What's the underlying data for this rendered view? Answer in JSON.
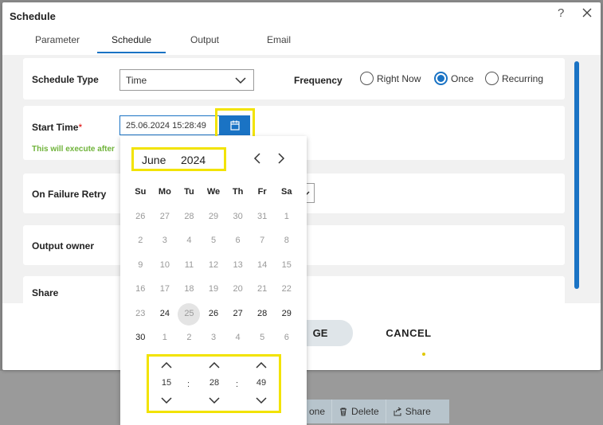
{
  "dialog": {
    "title": "Schedule",
    "help_label": "?",
    "tabs": [
      {
        "label": "Parameter",
        "active": false
      },
      {
        "label": "Schedule",
        "active": true
      },
      {
        "label": "Output",
        "active": false
      },
      {
        "label": "Email",
        "active": false
      }
    ]
  },
  "schedule_type": {
    "label": "Schedule Type",
    "value": "Time",
    "frequency_label": "Frequency",
    "options": [
      {
        "label": "Right Now",
        "checked": false
      },
      {
        "label": "Once",
        "checked": true
      },
      {
        "label": "Recurring",
        "checked": false
      }
    ]
  },
  "start_time": {
    "label": "Start Time",
    "required_mark": "*",
    "value": "25.06.2024 15:28:49",
    "note": "This will execute after"
  },
  "on_failure_retry": {
    "label": "On Failure Retry"
  },
  "output_owner": {
    "label": "Output owner"
  },
  "share": {
    "label": "Share"
  },
  "footer": {
    "change_label": "GE",
    "cancel_label": "CANCEL"
  },
  "background_toolbar": {
    "items": [
      {
        "label": "one",
        "icon": "partial-icon"
      },
      {
        "label": "Delete",
        "icon": "trash-icon"
      },
      {
        "label": "Share",
        "icon": "share-icon"
      }
    ]
  },
  "date_picker": {
    "month": "June",
    "year": "2024",
    "weekdays": [
      "Su",
      "Mo",
      "Tu",
      "We",
      "Th",
      "Fr",
      "Sa"
    ],
    "weeks": [
      [
        {
          "d": "26",
          "cur": false
        },
        {
          "d": "27",
          "cur": false
        },
        {
          "d": "28",
          "cur": false
        },
        {
          "d": "29",
          "cur": false
        },
        {
          "d": "30",
          "cur": false
        },
        {
          "d": "31",
          "cur": false
        },
        {
          "d": "1",
          "cur": false
        }
      ],
      [
        {
          "d": "2",
          "cur": false
        },
        {
          "d": "3",
          "cur": false
        },
        {
          "d": "4",
          "cur": false
        },
        {
          "d": "5",
          "cur": false
        },
        {
          "d": "6",
          "cur": false
        },
        {
          "d": "7",
          "cur": false
        },
        {
          "d": "8",
          "cur": false
        }
      ],
      [
        {
          "d": "9",
          "cur": false
        },
        {
          "d": "10",
          "cur": false
        },
        {
          "d": "11",
          "cur": false
        },
        {
          "d": "12",
          "cur": false
        },
        {
          "d": "13",
          "cur": false
        },
        {
          "d": "14",
          "cur": false
        },
        {
          "d": "15",
          "cur": false
        }
      ],
      [
        {
          "d": "16",
          "cur": false
        },
        {
          "d": "17",
          "cur": false
        },
        {
          "d": "18",
          "cur": false
        },
        {
          "d": "19",
          "cur": false
        },
        {
          "d": "20",
          "cur": false
        },
        {
          "d": "21",
          "cur": false
        },
        {
          "d": "22",
          "cur": false
        }
      ],
      [
        {
          "d": "23",
          "cur": false
        },
        {
          "d": "24",
          "cur": true
        },
        {
          "d": "25",
          "cur": false,
          "selected": true
        },
        {
          "d": "26",
          "cur": true
        },
        {
          "d": "27",
          "cur": true
        },
        {
          "d": "28",
          "cur": true
        },
        {
          "d": "29",
          "cur": true
        }
      ],
      [
        {
          "d": "30",
          "cur": true
        },
        {
          "d": "1",
          "cur": false
        },
        {
          "d": "2",
          "cur": false
        },
        {
          "d": "3",
          "cur": false
        },
        {
          "d": "4",
          "cur": false
        },
        {
          "d": "5",
          "cur": false
        },
        {
          "d": "6",
          "cur": false
        }
      ]
    ],
    "time": {
      "hours": "15",
      "minutes": "28",
      "seconds": "49",
      "separator": ":"
    }
  },
  "colors": {
    "accent": "#1a73c4",
    "highlight": "#f2e300",
    "note_green": "#6fb33a"
  }
}
